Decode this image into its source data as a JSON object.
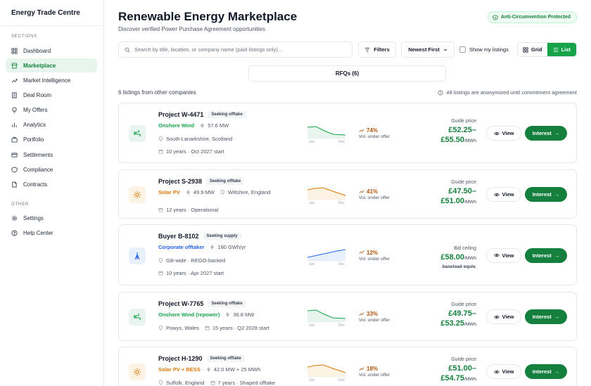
{
  "sidebar": {
    "brand": "Energy Trade Centre",
    "sections_label": "SECTIONS",
    "items": [
      {
        "label": "Dashboard",
        "icon": "grid-icon"
      },
      {
        "label": "Marketplace",
        "icon": "store-icon"
      },
      {
        "label": "Market Intelligence",
        "icon": "trend-icon"
      },
      {
        "label": "Deal Room",
        "icon": "building-icon"
      },
      {
        "label": "My Offers",
        "icon": "bulb-icon"
      },
      {
        "label": "Analytics",
        "icon": "bar-chart-icon"
      },
      {
        "label": "Portfolio",
        "icon": "briefcase-icon"
      },
      {
        "label": "Settlements",
        "icon": "card-icon"
      },
      {
        "label": "Compliance",
        "icon": "shield-icon"
      },
      {
        "label": "Contracts",
        "icon": "document-icon"
      }
    ],
    "active": "Marketplace",
    "other_label": "OTHER",
    "other_items": [
      {
        "label": "Settings",
        "icon": "gear-icon"
      },
      {
        "label": "Help Center",
        "icon": "help-icon"
      }
    ]
  },
  "header": {
    "title": "Renewable Energy Marketplace",
    "subtitle": "Discover verified Power Purchase Agreement opportunities",
    "badge": "Anti-Circumvention Protected"
  },
  "toolbar": {
    "search_placeholder": "Search by title, location, or company name (paid listings only)...",
    "filters_label": "Filters",
    "sort_label": "Newest First",
    "my_listings_label": "Show my listings",
    "grid_label": "Grid",
    "list_label": "List",
    "active_view": "List"
  },
  "rfq_tab": "RFQs (6)",
  "listing_count": "6 listings from other companies",
  "anon_note": "All listings are anonymized until commitment agreement",
  "colors": {
    "accent": "#15803d",
    "wind": "#16a34a",
    "solar": "#d97706",
    "buyer": "#2563eb"
  },
  "listings": [
    {
      "title": "Project W-4471",
      "status": "Seeking offtake",
      "tech": "Onshore Wind",
      "capacity": "57.6 MW",
      "location": "South Lanarkshire, Scotland",
      "term": "10 years · Oct 2027 start",
      "trend": "74%",
      "trend_sub": "Vol. under offer",
      "spark_start": "Jun",
      "spark_end": "Dec",
      "price_label": "Guide price",
      "price_line1": "£52.25–",
      "price_line2": "£55.50",
      "unit": "/MWh",
      "view_label": "View",
      "interest_label": "Interest",
      "kind": "wind"
    },
    {
      "title": "Project S-2938",
      "status": "Seeking offtake",
      "tech": "Solar PV",
      "capacity": "49.9 MW",
      "location": "Wiltshire, England",
      "term": "12 years · Operational",
      "trend": "41%",
      "trend_sub": "Vol. under offer",
      "spark_start": "Jun",
      "spark_end": "Dec",
      "price_label": "Guide price",
      "price_line1": "£47.50–",
      "price_line2": "£51.00",
      "unit": "/MWh",
      "view_label": "View",
      "interest_label": "Interest",
      "kind": "solar"
    },
    {
      "title": "Buyer B-8102",
      "status": "Seeking supply",
      "tech": "Corporate offtaker",
      "capacity": "180 GWh/yr",
      "location": "GB-wide · REGO-backed",
      "term": "10 years · Apr 2027 start",
      "trend": "12%",
      "trend_sub": "Vol. under offer",
      "spark_start": "Jun",
      "spark_end": "Dec",
      "price_label": "Bid ceiling",
      "price_line1": "£58.00",
      "unit": "/MWh",
      "price_note": "baseload equiv.",
      "view_label": "View",
      "interest_label": "Interest",
      "kind": "buyer"
    },
    {
      "title": "Project W-7765",
      "status": "Seeking offtake",
      "tech": "Onshore Wind (repower)",
      "capacity": "36.8 MW",
      "location": "Powys, Wales",
      "term": "15 years · Q2 2028 start",
      "trend": "33%",
      "trend_sub": "Vol. under offer",
      "spark_start": "Jun",
      "spark_end": "Dec",
      "price_label": "Guide price",
      "price_line1": "£49.75–",
      "price_line2": "£53.25",
      "unit": "/MWh",
      "view_label": "View",
      "interest_label": "Interest",
      "kind": "wind"
    },
    {
      "title": "Project H-1290",
      "status": "Seeking offtake",
      "tech": "Solar PV + BESS",
      "capacity": "42.0 MW + 25 MWh",
      "location": "Suffolk, England",
      "term": "7 years · Shaped offtake",
      "trend": "18%",
      "trend_sub": "Vol. under offer",
      "spark_start": "Jun",
      "spark_end": "Dec",
      "price_label": "Guide price",
      "price_line1": "£51.00–",
      "price_line2": "£54.75",
      "unit": "/MWh",
      "view_label": "View",
      "interest_label": "Interest",
      "kind": "solar"
    }
  ]
}
